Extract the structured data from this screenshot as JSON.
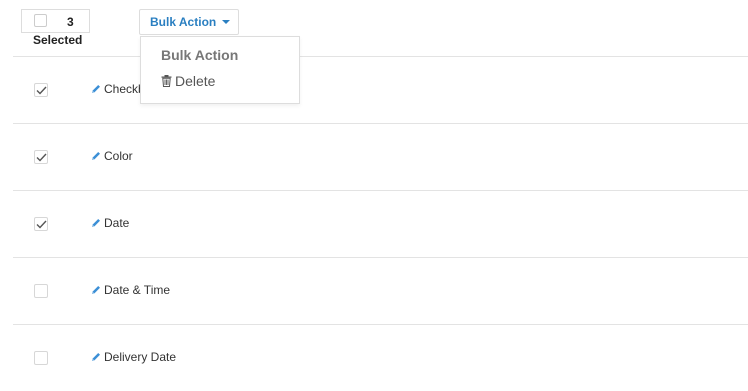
{
  "toolbar": {
    "selected_count": "3",
    "selected_label": "Selected",
    "bulk_action_label": "Bulk Action"
  },
  "bulk_menu": {
    "header": "Bulk Action",
    "items": [
      {
        "label": "Delete",
        "icon": "trash-icon"
      }
    ]
  },
  "rows": [
    {
      "label": "Checkbox",
      "checked": true,
      "icon": "pencil-icon"
    },
    {
      "label": "Color",
      "checked": true,
      "icon": "pencil-icon"
    },
    {
      "label": "Date",
      "checked": true,
      "icon": "pencil-icon"
    },
    {
      "label": "Date & Time",
      "checked": false,
      "icon": "pencil-icon"
    },
    {
      "label": "Delivery Date",
      "checked": false,
      "icon": "pencil-icon"
    }
  ],
  "colors": {
    "accent": "#2a7fc1",
    "pencil": "#3b8fd6",
    "divider": "#e3e3e3"
  }
}
